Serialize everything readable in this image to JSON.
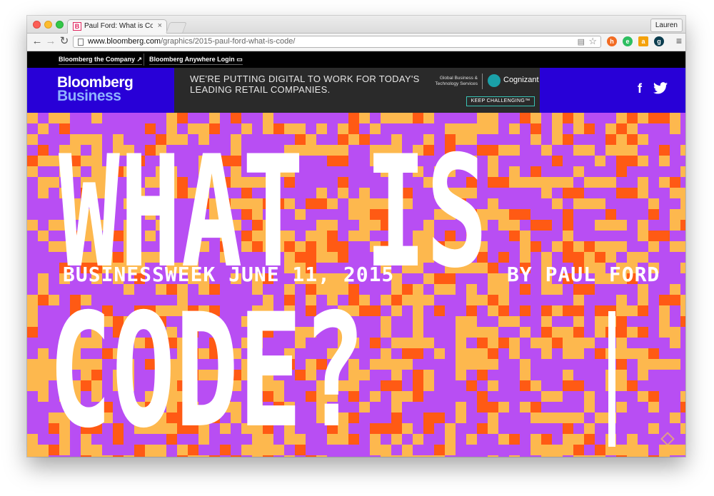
{
  "browser": {
    "tab_title": "Paul Ford: What is Code? |",
    "tab_favicon": "B",
    "user_label": "Lauren",
    "url_host": "www.bloomberg.com",
    "url_path": "/graphics/2015-paul-ford-what-is-code/",
    "icons": [
      "back-icon",
      "forward-icon",
      "reload-icon",
      "page-icon",
      "reader-icon",
      "bookmark-star-icon",
      "honey-extension-icon",
      "evernote-extension-icon",
      "amazon-extension-icon",
      "ghostery-extension-icon",
      "menu-icon"
    ]
  },
  "site": {
    "topbar_company": "Bloomberg the Company",
    "topbar_login": "Bloomberg Anywhere Login",
    "logo_line1": "Bloomberg",
    "logo_line2": "Business",
    "ad_text": "WE'RE PUTTING DIGITAL TO WORK FOR  TODAY'S LEADING RETAIL COMPANIES.",
    "ad_sub": "Global Business & Technology Services",
    "ad_brand": "Cognizant",
    "ad_cta": "KEEP CHALLENGING™",
    "social_facebook": "f"
  },
  "hero": {
    "title_line1": "WHAT IS",
    "title_line2": "CODE?",
    "byline_left": "BUSINESSWEEK JUNE 11, 2015",
    "byline_right": "BY PAUL FORD",
    "colors": {
      "purple": "#b84ef3",
      "orange": "#ff5a14",
      "yellow": "#fdb84e"
    }
  }
}
